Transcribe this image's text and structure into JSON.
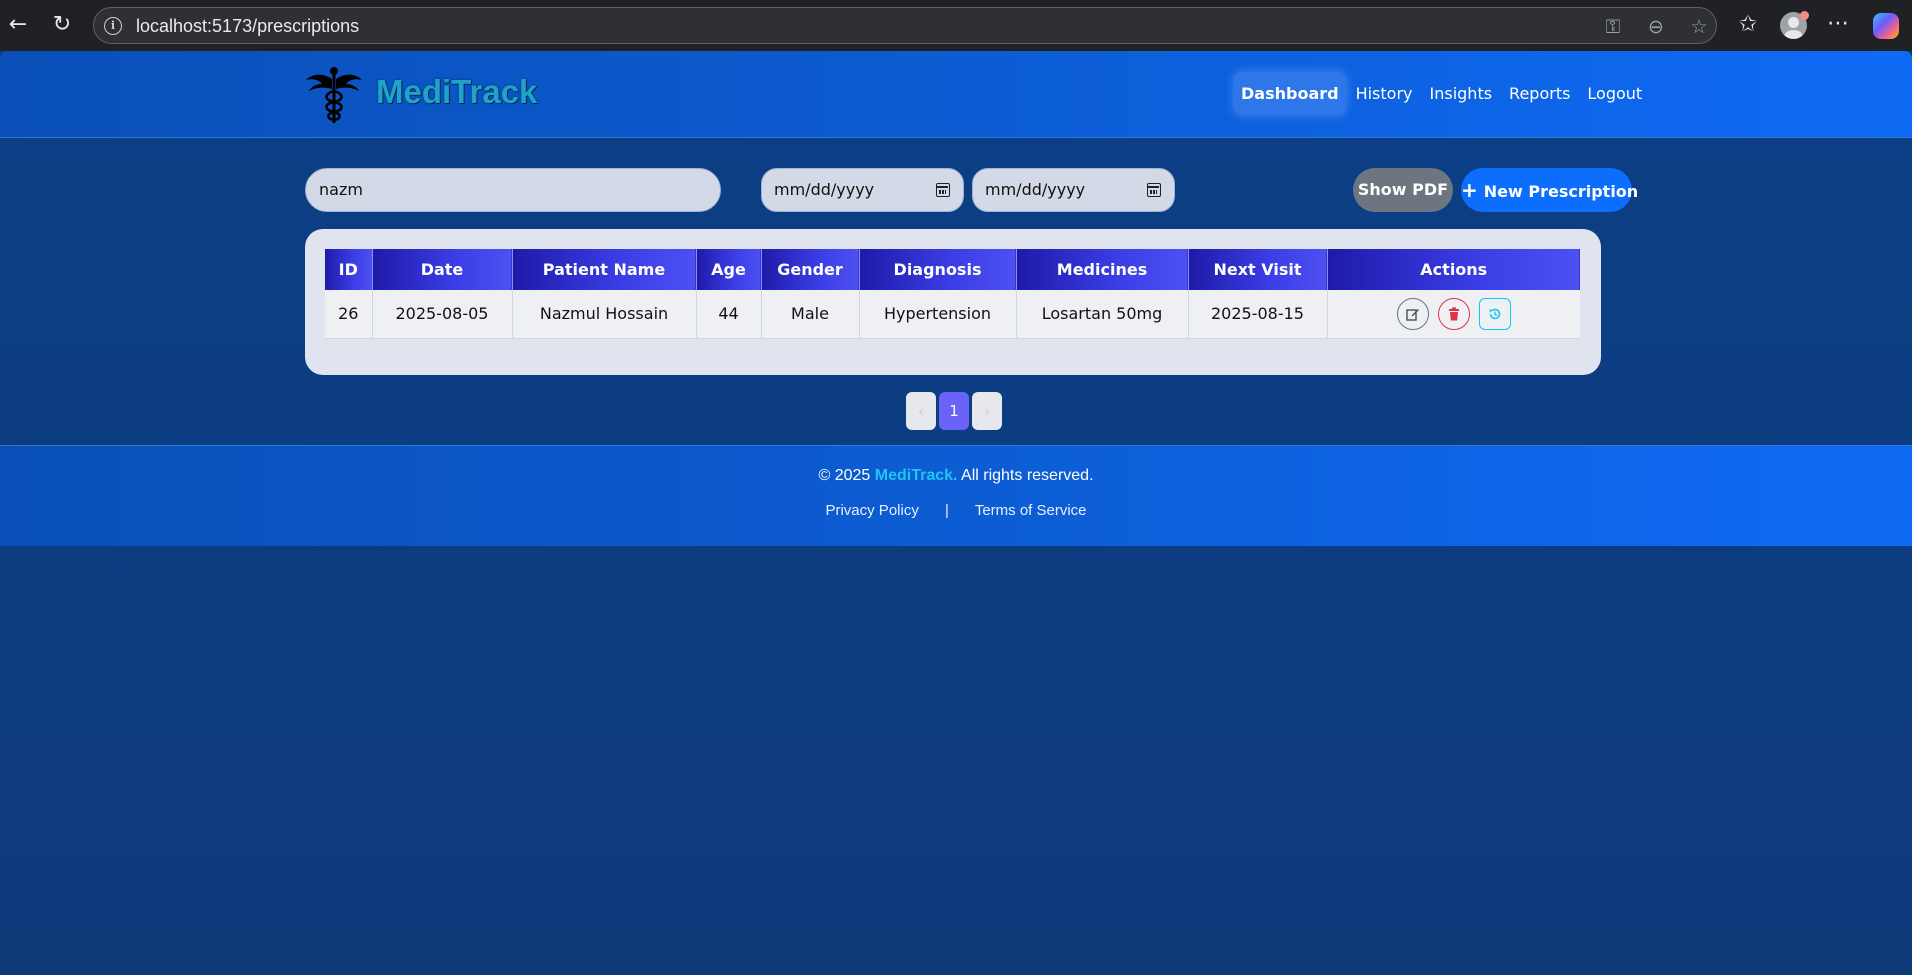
{
  "browser": {
    "url": "localhost:5173/prescriptions",
    "back_icon": "back-arrow-icon",
    "reload_icon": "reload-icon"
  },
  "nav": {
    "brand": "MediTrack",
    "links": [
      "Dashboard",
      "History",
      "Insights",
      "Reports",
      "Logout"
    ],
    "active": "Dashboard"
  },
  "filters": {
    "search_value": "nazm",
    "date_from_placeholder": "mm/dd/yyyy",
    "date_to_placeholder": "mm/dd/yyyy",
    "show_pdf_label": "Show PDF",
    "new_prescription_label": "New Prescription"
  },
  "table": {
    "headers": [
      "ID",
      "Date",
      "Patient Name",
      "Age",
      "Gender",
      "Diagnosis",
      "Medicines",
      "Next Visit",
      "Actions"
    ],
    "rows": [
      [
        "26",
        "2025-08-05",
        "Nazmul Hossain",
        "44",
        "Male",
        "Hypertension",
        "Losartan 50mg",
        "2025-08-15"
      ]
    ]
  },
  "pagination": {
    "prev": "‹",
    "current": "1",
    "next": "›"
  },
  "footer": {
    "copyright_prefix": "© 2025",
    "brand": "MediTrack.",
    "copyright_suffix": "All rights reserved.",
    "privacy": "Privacy Policy",
    "separator": "|",
    "terms": "Terms of Service"
  },
  "colors": {
    "navbar": "#0c5bd0",
    "page_bg": "#0e3b7d",
    "table_header": "#3b3ee6",
    "primary_button": "#0d6efd",
    "secondary_button": "#6c7580",
    "pagination_active": "#6b63f7",
    "brand_accent": "#22c5f2"
  }
}
